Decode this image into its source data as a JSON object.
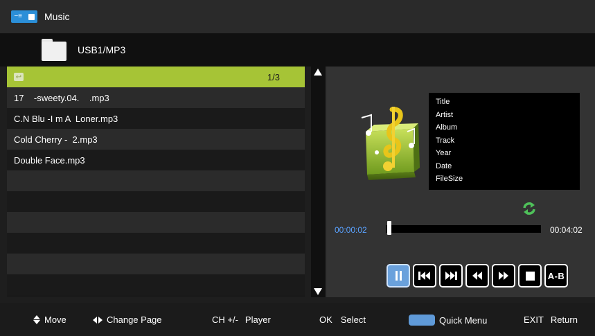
{
  "header": {
    "title": "Music",
    "icon": "usb-device-icon"
  },
  "path": {
    "label": "USB1/MP3",
    "icon": "folder-icon"
  },
  "filelist": {
    "page_indicator": "1/3",
    "files": [
      "17    -sweety.04.    .mp3",
      "C.N Blu -I m A  Loner.mp3",
      "Cold Cherry -  2.mp3",
      "Double Face.mp3"
    ]
  },
  "player": {
    "info_fields": [
      "Title",
      "Artist",
      "Album",
      "Track",
      "Year",
      "Date",
      "FileSize"
    ],
    "current_time": "00:00:02",
    "total_time": "00:04:02",
    "progress": 0.008,
    "ab_label": "A-B",
    "accent_color": "#6aa1dc",
    "repeat_color": "#4fc15a"
  },
  "footer": {
    "move": "Move",
    "change_page": "Change Page",
    "ch_key": "CH +/-",
    "player": "Player",
    "ok_key": "OK",
    "select": "Select",
    "quick_menu": "Quick Menu",
    "exit_key": "EXIT",
    "return": "Return"
  }
}
